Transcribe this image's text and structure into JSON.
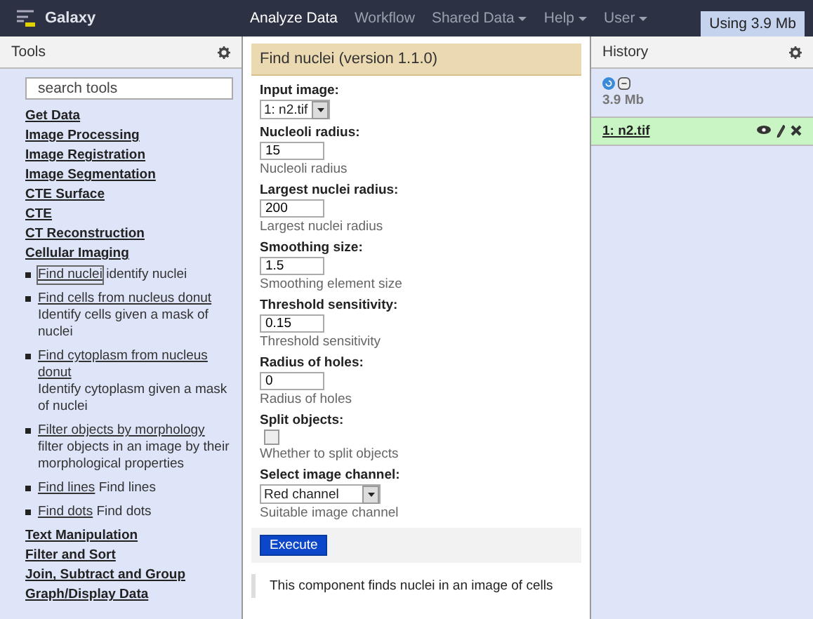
{
  "masthead": {
    "brand": "Galaxy",
    "nav": [
      {
        "label": "Analyze Data",
        "selected": true,
        "has_menu": false
      },
      {
        "label": "Workflow",
        "selected": false,
        "has_menu": false
      },
      {
        "label": "Shared Data",
        "selected": false,
        "has_menu": true
      },
      {
        "label": "Help",
        "selected": false,
        "has_menu": true
      },
      {
        "label": "User",
        "selected": false,
        "has_menu": true
      }
    ],
    "usage": "Using 3.9 Mb"
  },
  "tools": {
    "title": "Tools",
    "search": {
      "placeholder": "search tools"
    },
    "sections": [
      {
        "name": "Get Data"
      },
      {
        "name": "Image Processing"
      },
      {
        "name": "Image Registration"
      },
      {
        "name": "Image Segmentation"
      },
      {
        "name": "CTE Surface"
      },
      {
        "name": "CTE"
      },
      {
        "name": "CT Reconstruction"
      },
      {
        "name": "Cellular Imaging",
        "tools": [
          {
            "name": "Find nuclei",
            "description": "identify nuclei",
            "selected": true
          },
          {
            "name": "Find cells from nucleus donut",
            "description": "Identify cells given a mask of nuclei",
            "selected": false
          },
          {
            "name": "Find cytoplasm from nucleus donut",
            "description": "Identify cytoplasm given a mask of nuclei",
            "selected": false
          },
          {
            "name": "Filter objects by morphology",
            "description": "filter objects in an image by their morphological properties",
            "selected": false
          },
          {
            "name": "Find lines",
            "description": "Find lines",
            "selected": false
          },
          {
            "name": "Find dots",
            "description": "Find dots",
            "selected": false
          }
        ]
      },
      {
        "name": "Text Manipulation"
      },
      {
        "name": "Filter and Sort"
      },
      {
        "name": "Join, Subtract and Group"
      },
      {
        "name": "Graph/Display Data"
      }
    ]
  },
  "form": {
    "title": "Find nuclei (version 1.1.0)",
    "params": [
      {
        "kind": "select",
        "label": "Input image:",
        "value": "1: n2.tif"
      },
      {
        "kind": "text",
        "label": "Nucleoli radius:",
        "value": "15",
        "help": "Nucleoli radius"
      },
      {
        "kind": "text",
        "label": "Largest nuclei radius:",
        "value": "200",
        "help": "Largest nuclei radius"
      },
      {
        "kind": "text",
        "label": "Smoothing size:",
        "value": "1.5",
        "help": "Smoothing element size"
      },
      {
        "kind": "text",
        "label": "Threshold sensitivity:",
        "value": "0.15",
        "help": "Threshold sensitivity"
      },
      {
        "kind": "text",
        "label": "Radius of holes:",
        "value": "0",
        "help": "Radius of holes"
      },
      {
        "kind": "checkbox",
        "label": "Split objects:",
        "checked": false,
        "help": "Whether to split objects"
      },
      {
        "kind": "select",
        "label": "Select image channel:",
        "value": "Red channel",
        "help": "Suitable image channel"
      }
    ],
    "execute": "Execute",
    "description": "This component finds nuclei in an image of cells"
  },
  "history": {
    "title": "History",
    "size": "3.9 Mb",
    "items": [
      {
        "label": "1: n2.tif"
      }
    ]
  }
}
